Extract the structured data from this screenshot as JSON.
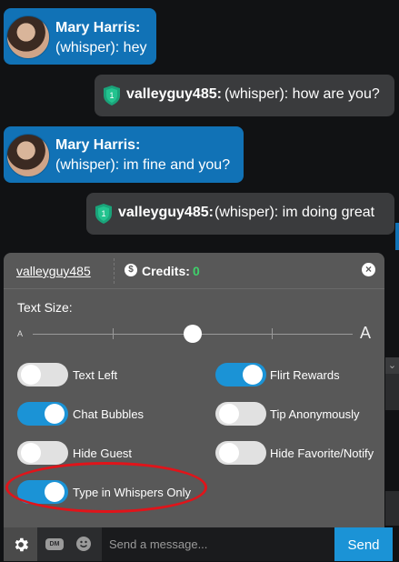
{
  "messages": [
    {
      "sender": "Mary Harris:",
      "text": "(whisper): hey",
      "direction": "in"
    },
    {
      "sender": "valleyguy485:",
      "text": "(whisper): how are you?",
      "direction": "out",
      "badge": "1"
    },
    {
      "sender": "Mary Harris:",
      "text": "(whisper): im fine and you?",
      "direction": "in"
    },
    {
      "sender": "valleyguy485:",
      "text": "(whisper): im doing great",
      "direction": "out",
      "badge": "1"
    }
  ],
  "panel": {
    "username": "valleyguy485",
    "credits_label": "Credits:",
    "credits_value": "0",
    "credits_icon": "$",
    "close_icon": "×",
    "text_size_label": "Text Size:",
    "size_small": "A",
    "size_large": "A",
    "text_size_level": 0.5,
    "toggles": [
      {
        "label": "Text Left",
        "on": false
      },
      {
        "label": "Flirt Rewards",
        "on": true
      },
      {
        "label": "Chat Bubbles",
        "on": true
      },
      {
        "label": "Tip Anonymously",
        "on": false
      },
      {
        "label": "Hide Guest",
        "on": false
      },
      {
        "label": "Hide Favorite/Notify",
        "on": false
      },
      {
        "label": "Type in Whispers Only",
        "on": true
      }
    ]
  },
  "bottom": {
    "dm_label": "DM",
    "placeholder": "Send a message...",
    "send_label": "Send"
  },
  "colors": {
    "accent": "#1b93d6",
    "incoming": "#1172b6",
    "outgoing": "#3a3b3d",
    "credits": "#3fd16b",
    "highlight": "#e0141a",
    "badge": "#1aa37a"
  }
}
